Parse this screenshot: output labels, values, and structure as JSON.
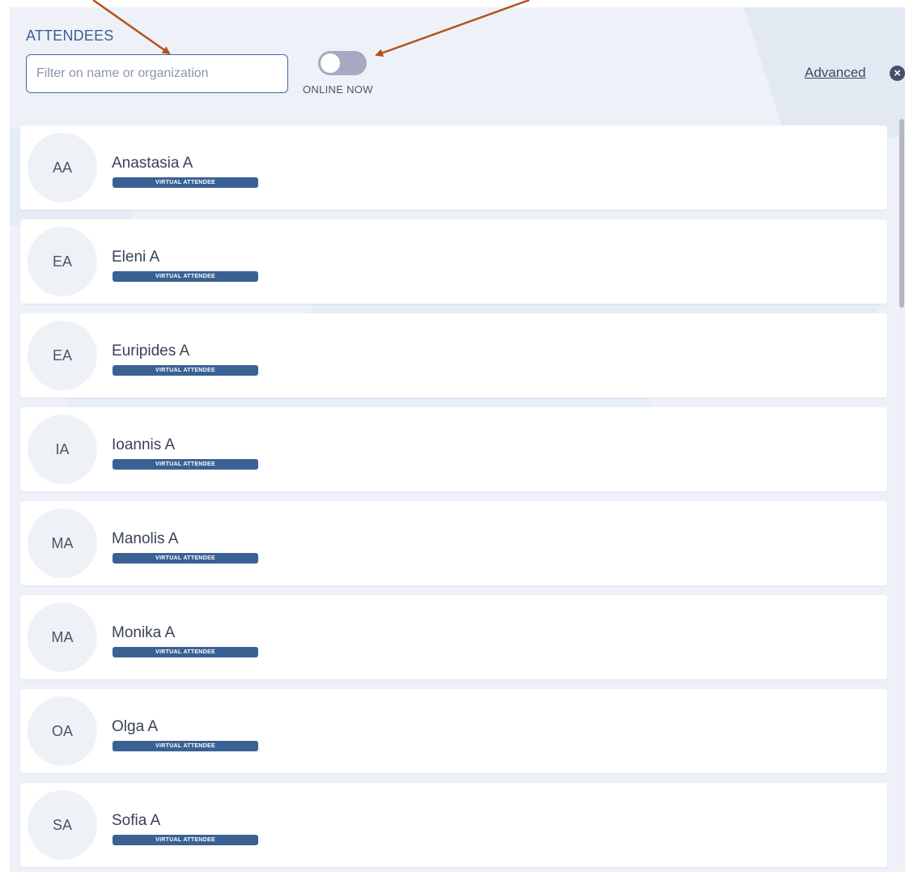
{
  "header": {
    "title": "ATTENDEES",
    "search_placeholder": "Filter on name or organization",
    "search_value": "",
    "online_toggle_label": "ONLINE NOW",
    "online_toggle_on": false,
    "advanced_label": "Advanced",
    "clear_icon": "close-circle-icon"
  },
  "attendees": [
    {
      "initials": "AA",
      "name": "Anastasia A",
      "badge": "VIRTUAL ATTENDEE"
    },
    {
      "initials": "EA",
      "name": "Eleni A",
      "badge": "VIRTUAL ATTENDEE"
    },
    {
      "initials": "EA",
      "name": "Euripides A",
      "badge": "VIRTUAL ATTENDEE"
    },
    {
      "initials": "IA",
      "name": "Ioannis A",
      "badge": "VIRTUAL ATTENDEE"
    },
    {
      "initials": "MA",
      "name": "Manolis A",
      "badge": "VIRTUAL ATTENDEE"
    },
    {
      "initials": "MA",
      "name": "Monika A",
      "badge": "VIRTUAL ATTENDEE"
    },
    {
      "initials": "OA",
      "name": "Olga A",
      "badge": "VIRTUAL ATTENDEE"
    },
    {
      "initials": "SA",
      "name": "Sofia A",
      "badge": "VIRTUAL ATTENDEE"
    }
  ],
  "colors": {
    "accent": "#3a6194",
    "annotation_arrow": "#b5521c"
  }
}
